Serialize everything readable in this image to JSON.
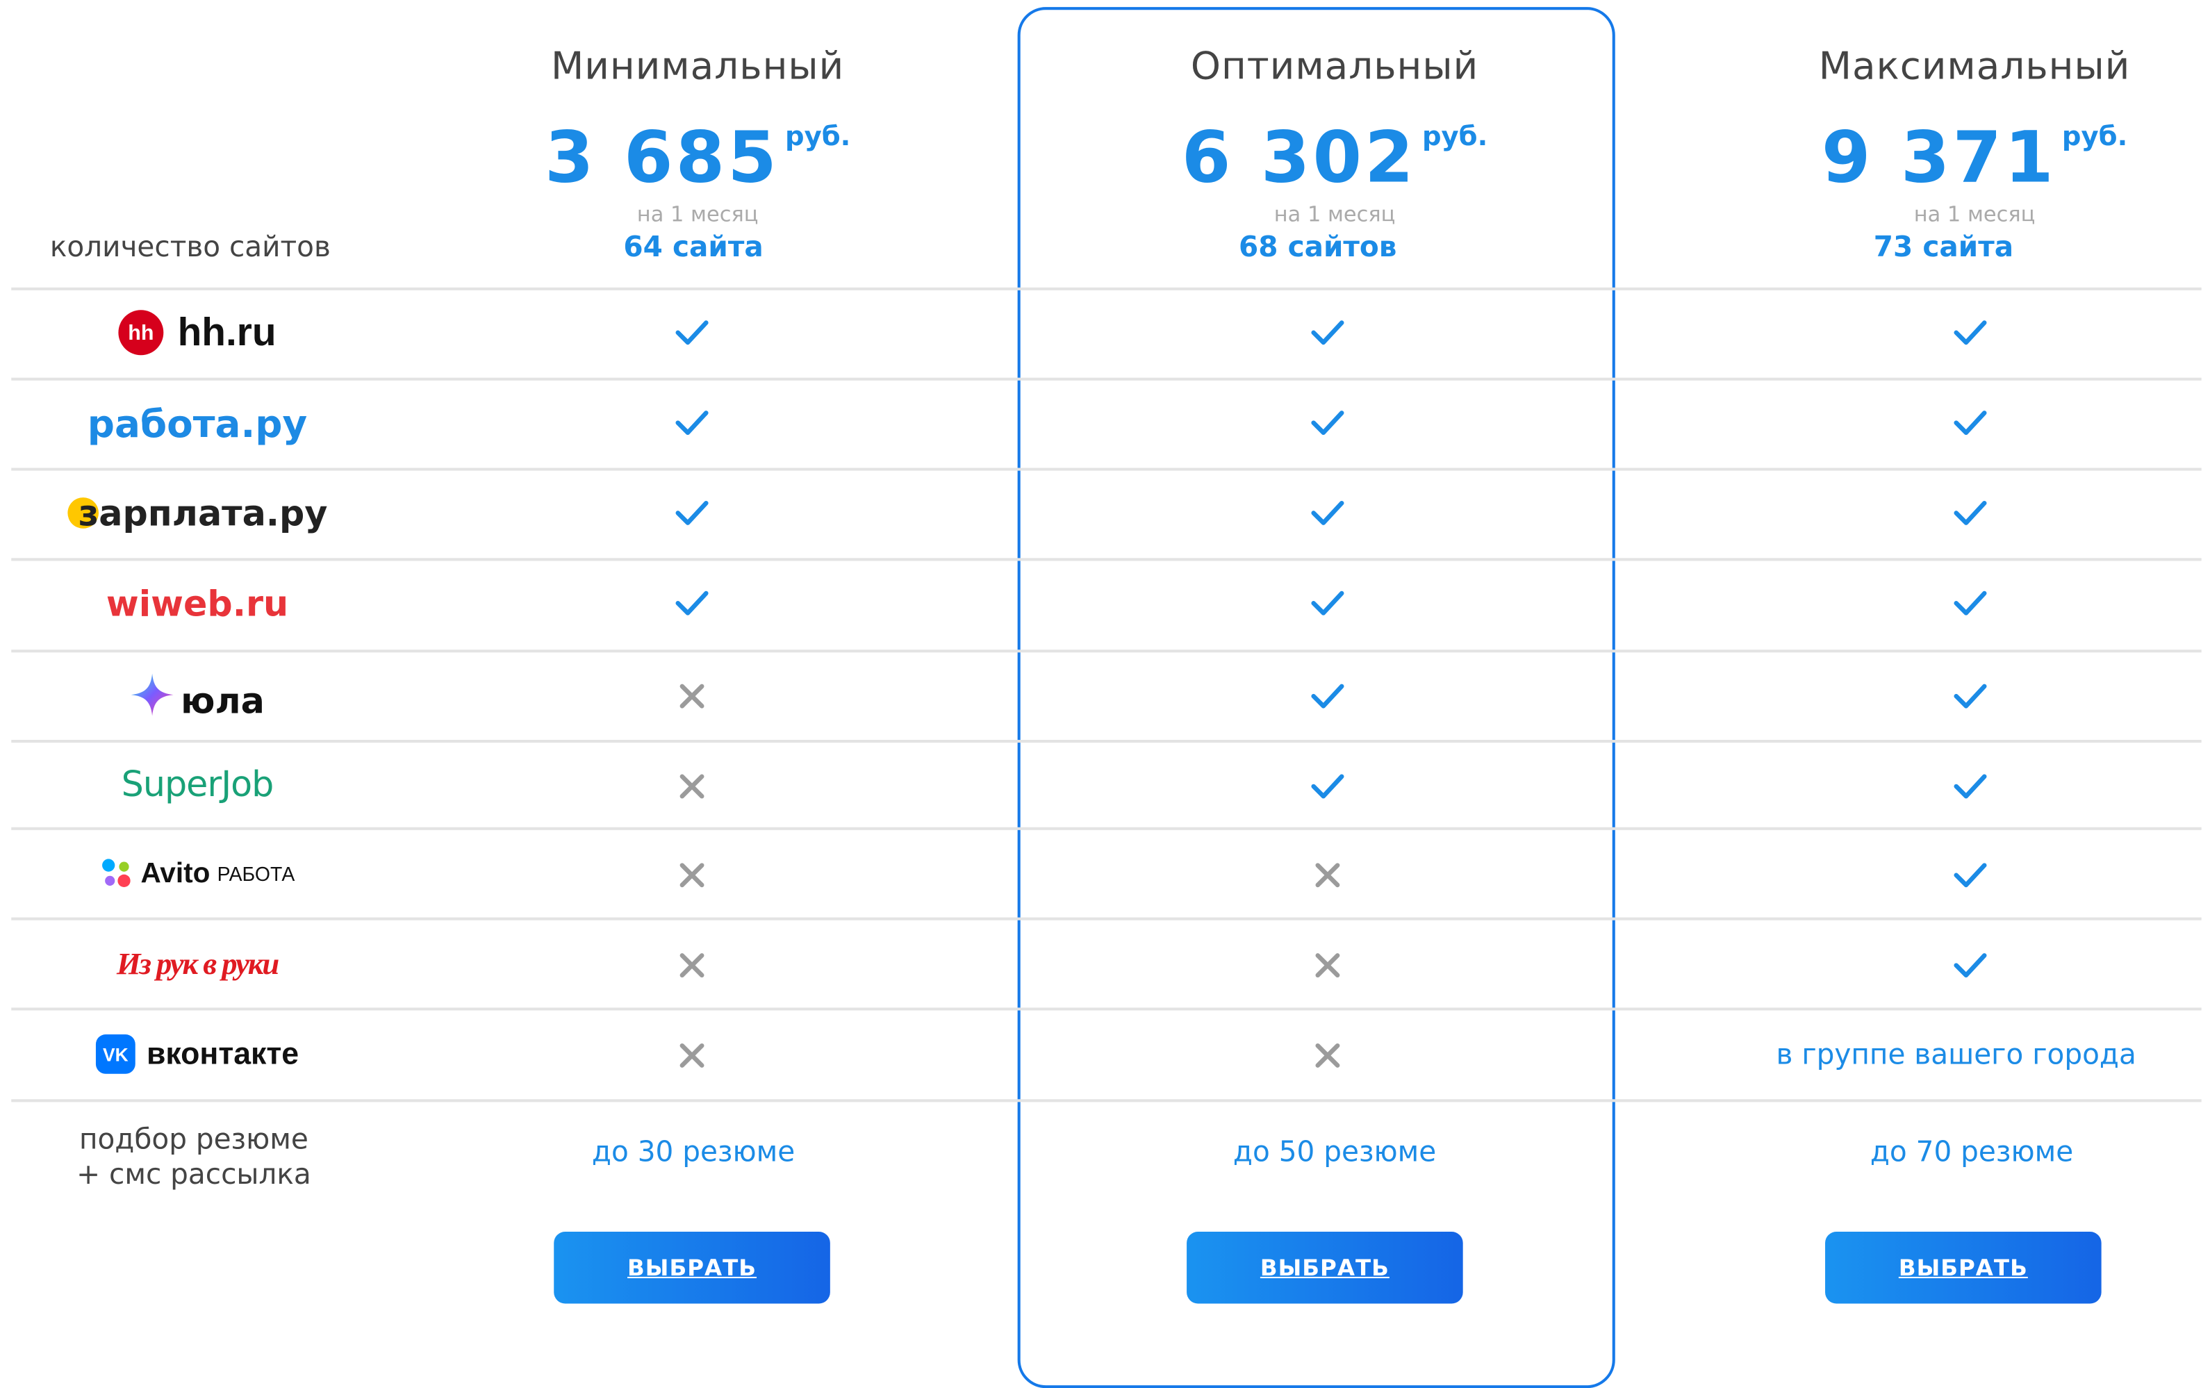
{
  "plans": [
    {
      "name": "Минимальный",
      "price": "3 685",
      "currency": "руб.",
      "period": "на 1 месяц",
      "sites": "64 сайта",
      "resume": "до 30 резюме",
      "button": "ВЫБРАТЬ"
    },
    {
      "name": "Оптимальный",
      "price": "6 302",
      "currency": "руб.",
      "period": "на 1 месяц",
      "sites": "68 сайтов",
      "resume": "до 50 резюме",
      "button": "ВЫБРАТЬ"
    },
    {
      "name": "Максимальный",
      "price": "9 371",
      "currency": "руб.",
      "period": "на 1 месяц",
      "sites": "73 сайта",
      "resume": "до 70 резюме",
      "button": "ВЫБРАТЬ"
    }
  ],
  "labels": {
    "site_count": "количество сайтов",
    "resume_line1": "подбор резюме",
    "resume_line2": "+ смс рассылка"
  },
  "sites": [
    {
      "logo": "hh.ru",
      "badge": "hh",
      "icon": "hh-logo-icon",
      "availability": [
        "check",
        "check",
        "check"
      ]
    },
    {
      "logo": "работа.ру",
      "icon": "rabota-ru-logo",
      "availability": [
        "check",
        "check",
        "check"
      ]
    },
    {
      "logo": "зарплата.ру",
      "icon": "zarplata-ru-logo",
      "availability": [
        "check",
        "check",
        "check"
      ]
    },
    {
      "logo": "wiweb.ru",
      "icon": "wiweb-ru-logo",
      "availability": [
        "check",
        "check",
        "check"
      ]
    },
    {
      "logo": "юла",
      "icon": "youla-star-icon",
      "availability": [
        "cross",
        "check",
        "check"
      ]
    },
    {
      "logo": "SuperJob",
      "icon": "superjob-logo",
      "availability": [
        "cross",
        "check",
        "check"
      ]
    },
    {
      "logo": "Avito",
      "logo_suffix": "РАБОТА",
      "icon": "avito-dots-icon",
      "availability": [
        "cross",
        "cross",
        "check"
      ]
    },
    {
      "logo": "Из рук в руки",
      "icon": "iz-ruk-v-ruki-logo",
      "availability": [
        "cross",
        "cross",
        "check"
      ]
    },
    {
      "logo": "вконтакте",
      "badge": "VK",
      "icon": "vk-logo-icon",
      "availability": [
        "cross",
        "cross",
        "в группе вашего города"
      ]
    }
  ],
  "colors": {
    "accent": "#1b8be6",
    "highlight_border": "#1579e9",
    "check": "#1b8be6",
    "cross": "#9b9b9b",
    "hh": "#d6001c",
    "rabota": "#1d8ae4",
    "wiweb": "#e8343a",
    "superjob": "#19a177",
    "vk": "#0077ff",
    "iz_ruk": "#e01b22"
  }
}
